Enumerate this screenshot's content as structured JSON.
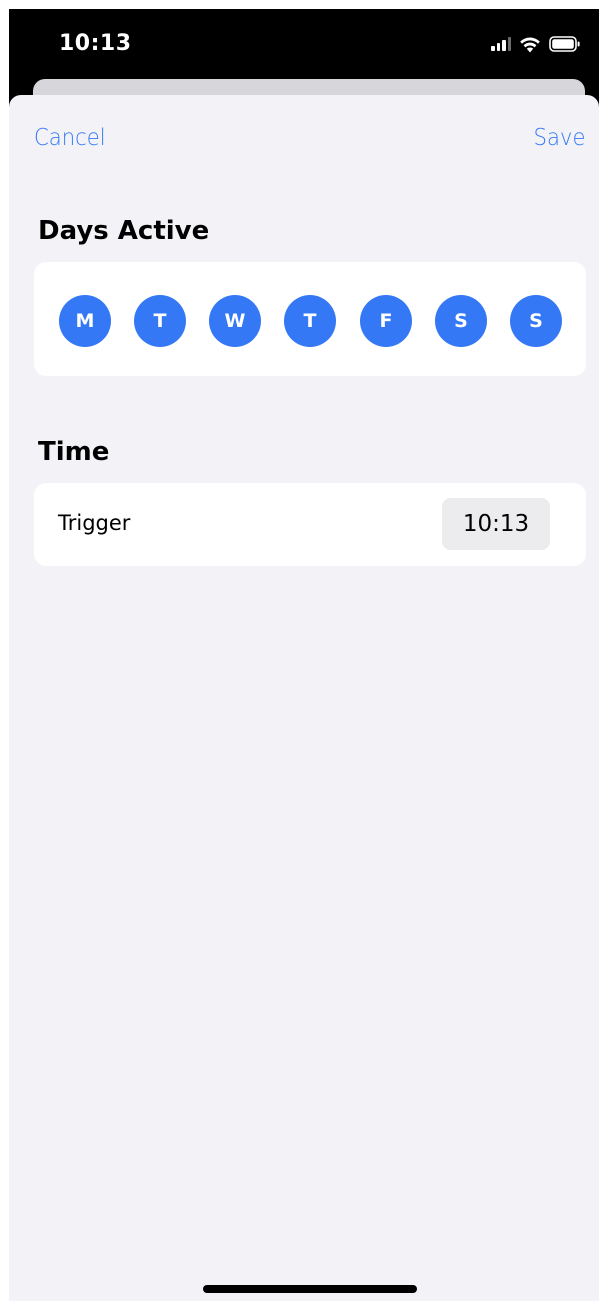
{
  "status_bar": {
    "time": "10:13",
    "icons": [
      "signal-icon",
      "wifi-icon",
      "battery-icon"
    ]
  },
  "nav": {
    "cancel_label": "Cancel",
    "save_label": "Save"
  },
  "days_section": {
    "title": "Days Active",
    "days": [
      {
        "label": "M",
        "selected": true
      },
      {
        "label": "T",
        "selected": true
      },
      {
        "label": "W",
        "selected": true
      },
      {
        "label": "T",
        "selected": true
      },
      {
        "label": "F",
        "selected": true
      },
      {
        "label": "S",
        "selected": true
      },
      {
        "label": "S",
        "selected": true
      }
    ]
  },
  "time_section": {
    "title": "Time",
    "trigger_label": "Trigger",
    "trigger_value": "10:13"
  },
  "colors": {
    "accent": "#3478f6",
    "sheet_background": "#f2f2f7",
    "card_background": "#ffffff",
    "picker_background": "#ececee"
  }
}
